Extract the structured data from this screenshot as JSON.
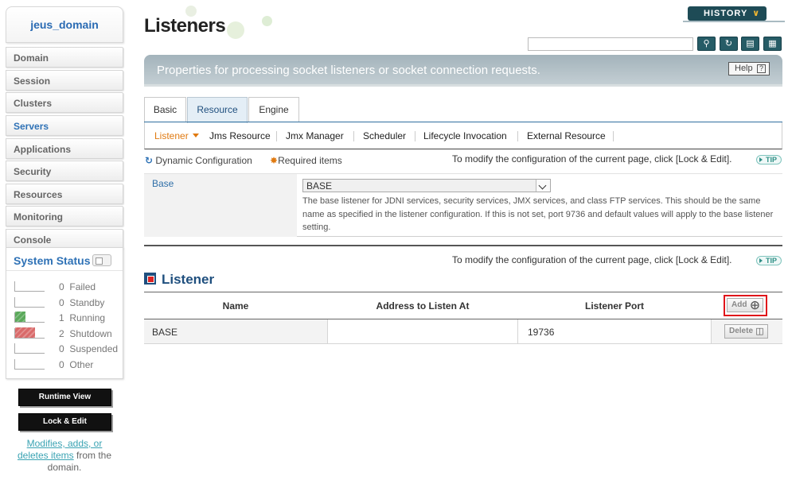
{
  "sidebar": {
    "domain_name": "jeus_domain",
    "items": [
      {
        "label": "Domain",
        "active": false
      },
      {
        "label": "Session",
        "active": false
      },
      {
        "label": "Clusters",
        "active": false
      },
      {
        "label": "Servers",
        "active": true
      },
      {
        "label": "Applications",
        "active": false
      },
      {
        "label": "Security",
        "active": false
      },
      {
        "label": "Resources",
        "active": false
      },
      {
        "label": "Monitoring",
        "active": false
      },
      {
        "label": "Console",
        "active": false
      }
    ],
    "system_status": {
      "title": "System Status",
      "rows": [
        {
          "count": "0",
          "label": "Failed",
          "color": "#ffffff",
          "level": 0
        },
        {
          "count": "0",
          "label": "Standby",
          "color": "#ffffff",
          "level": 0
        },
        {
          "count": "1",
          "label": "Running",
          "color": "#5aa85a",
          "level": 0.33
        },
        {
          "count": "2",
          "label": "Shutdown",
          "color": "#d96a6a",
          "level": 0.67
        },
        {
          "count": "0",
          "label": "Suspended",
          "color": "#ffffff",
          "level": 0
        },
        {
          "count": "0",
          "label": "Other",
          "color": "#ffffff",
          "level": 0
        }
      ]
    },
    "runtime_view_label": "Runtime View",
    "lock_edit_label": "Lock & Edit",
    "note_link": "Modifies, adds, or deletes items",
    "note_rest": "from the domain."
  },
  "header": {
    "title": "Listeners",
    "history_label": "HISTORY",
    "search_placeholder": ""
  },
  "banner": {
    "text": "Properties for processing socket listeners or socket connection requests.",
    "help_label": "Help"
  },
  "tabs": [
    {
      "label": "Basic",
      "active": false
    },
    {
      "label": "Resource",
      "active": true
    },
    {
      "label": "Engine",
      "active": false
    }
  ],
  "subnav": [
    {
      "label": "Listener",
      "active": true
    },
    {
      "label": "Jms Resource",
      "active": false
    },
    {
      "label": "Jmx Manager",
      "active": false
    },
    {
      "label": "Scheduler",
      "active": false
    },
    {
      "label": "Lifecycle Invocation",
      "active": false
    },
    {
      "label": "External Resource",
      "active": false
    }
  ],
  "legend": {
    "dynamic": "Dynamic Configuration",
    "required": "Required items"
  },
  "tip": {
    "text": "To modify the configuration of the current page, click [Lock & Edit].",
    "badge": "TIP"
  },
  "base_field": {
    "label": "Base",
    "value": "BASE",
    "description": "The base listener for JDNI services, security services, JMX services, and class FTP services. This should be the same name as specified in the listener configuration. If this is not set, port 9736 and default values will apply to the base listener setting."
  },
  "listener_section": {
    "title": "Listener",
    "columns": [
      "Name",
      "Address to Listen At",
      "Listener Port"
    ],
    "add_label": "Add",
    "rows": [
      {
        "name": "BASE",
        "address": "",
        "port": "19736",
        "delete_label": "Delete"
      }
    ]
  },
  "colors": {
    "accent_blue": "#2f72b6",
    "active_subnav": "#e07a11",
    "banner": "#b3c1c7",
    "highlight": "#e0141a"
  }
}
